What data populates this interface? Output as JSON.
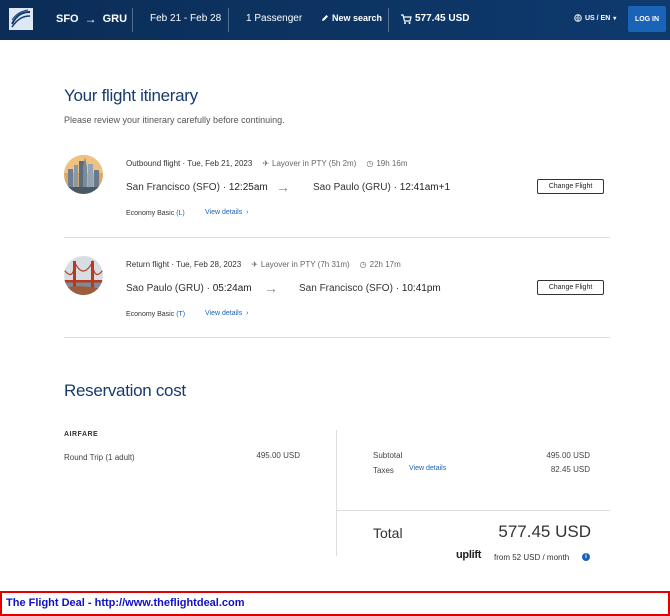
{
  "header": {
    "origin": "SFO",
    "arrow": "→",
    "destination": "GRU",
    "dates": "Feb 21 - Feb 28",
    "passengers": "1 Passenger",
    "new_search": "New search",
    "cart_total": "577.45 USD",
    "locale": "US / EN",
    "login": "LOG IN"
  },
  "page": {
    "title": "Your flight itinerary",
    "subtitle": "Please review your itinerary carefully before continuing."
  },
  "flights": [
    {
      "label": "Outbound flight · Tue, Feb 21, 2023",
      "layover": "Layover in PTY (5h 2m)",
      "duration": "19h 16m",
      "from_city": "San Francisco (SFO) ·",
      "from_time": "12:25am",
      "to_city": "Sao Paulo (GRU) ·",
      "to_time": "12:41am+1",
      "change": "Change Flight",
      "cabin": "Economy Basic",
      "cabin_code": "(L)",
      "details": "View details"
    },
    {
      "label": "Return flight · Tue, Feb 28, 2023",
      "layover": "Layover in PTY (7h 31m)",
      "duration": "22h 17m",
      "from_city": "Sao Paulo (GRU) ·",
      "from_time": "05:24am",
      "to_city": "San Francisco (SFO) ·",
      "to_time": "10:41pm",
      "change": "Change Flight",
      "cabin": "Economy Basic",
      "cabin_code": "(T)",
      "details": "View details"
    }
  ],
  "reservation": {
    "title": "Reservation cost",
    "airfare_label": "AIRFARE",
    "trip_type": "Round Trip",
    "trip_pax": "(1 adult)",
    "trip_price": "495.00 USD",
    "subtotal_label": "Subtotal",
    "subtotal_value": "495.00 USD",
    "taxes_label": "Taxes",
    "taxes_link": "View details",
    "taxes_value": "82.45 USD",
    "total_label": "Total",
    "total_value": "577.45 USD",
    "uplift_brand": "uplift",
    "uplift_text": "from 52 USD  / month"
  },
  "footer": {
    "banner": "The Flight Deal - http://www.theflightdeal.com"
  },
  "colors": {
    "header_bg": "#0e3a6e",
    "title": "#173b6c",
    "link": "#1a64b8",
    "banner_border": "#e00000",
    "banner_text": "#1010c8"
  }
}
